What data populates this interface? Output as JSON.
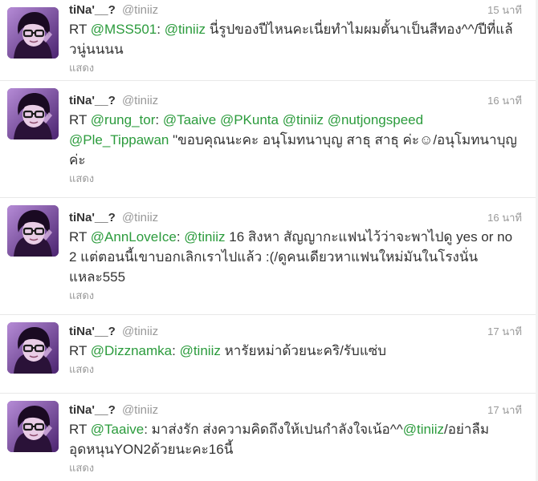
{
  "tweets": [
    {
      "name": "tiNa'__?",
      "handle": "@tiniiz",
      "time": "15 นาที",
      "parts": [
        {
          "t": "RT "
        },
        {
          "t": "@MSS501",
          "m": true
        },
        {
          "t": ": "
        },
        {
          "t": "@tiniiz",
          "m": true
        },
        {
          "t": " นี่รูปของปีไหนคะเนี่ยทำไมผมตั้นาเป็นสีทอง^^/ปีที่แล้วนู่นนนน"
        }
      ],
      "show": "แสดง"
    },
    {
      "name": "tiNa'__?",
      "handle": "@tiniiz",
      "time": "16 นาที",
      "parts": [
        {
          "t": "RT "
        },
        {
          "t": "@rung_tor",
          "m": true
        },
        {
          "t": ": "
        },
        {
          "t": "@Taaive",
          "m": true
        },
        {
          "t": " "
        },
        {
          "t": "@PKunta",
          "m": true
        },
        {
          "t": " "
        },
        {
          "t": "@tiniiz",
          "m": true
        },
        {
          "t": " "
        },
        {
          "t": "@nutjongspeed",
          "m": true
        },
        {
          "t": " "
        },
        {
          "t": "@Ple_Tippawan",
          "m": true
        },
        {
          "t": " \"ขอบคุณนะคะ อนุโมทนาบุญ สาธุ สาธุ ค่ะ☺/อนุโมทนาบุญค่ะ"
        }
      ],
      "show": "แสดง"
    },
    {
      "name": "tiNa'__?",
      "handle": "@tiniiz",
      "time": "16 นาที",
      "parts": [
        {
          "t": "RT "
        },
        {
          "t": "@AnnLoveIce",
          "m": true
        },
        {
          "t": ": "
        },
        {
          "t": "@tiniiz",
          "m": true
        },
        {
          "t": " 16 สิงหา สัญญากะแฟนไว้ว่าจะพาไปดู yes or no 2 แต่ตอนนี้เขาบอกเลิกเราไปแล้ว :(/ดูคนเดียวหาแฟนใหม่มันในโรงนั่นแหละ555"
        }
      ],
      "show": "แสดง"
    },
    {
      "name": "tiNa'__?",
      "handle": "@tiniiz",
      "time": "17 นาที",
      "parts": [
        {
          "t": "RT "
        },
        {
          "t": "@Dizznamka",
          "m": true
        },
        {
          "t": ": "
        },
        {
          "t": "@tiniiz",
          "m": true
        },
        {
          "t": " หารัยหม่าด้วยนะคริ/รับแซ่บ"
        }
      ],
      "show": "แสดง"
    },
    {
      "name": "tiNa'__?",
      "handle": "@tiniiz",
      "time": "17 นาที",
      "parts": [
        {
          "t": "RT "
        },
        {
          "t": "@Taaive",
          "m": true
        },
        {
          "t": ": มาส่งรัก ส่งความคิดถึงให้เปนกำลังใจเน้อ^^"
        },
        {
          "t": "@tiniiz",
          "m": true
        },
        {
          "t": "/อย่าลืมอุดหนุนYON2ด้วยนะคะ16นี้"
        }
      ],
      "show": "แสดง"
    }
  ]
}
